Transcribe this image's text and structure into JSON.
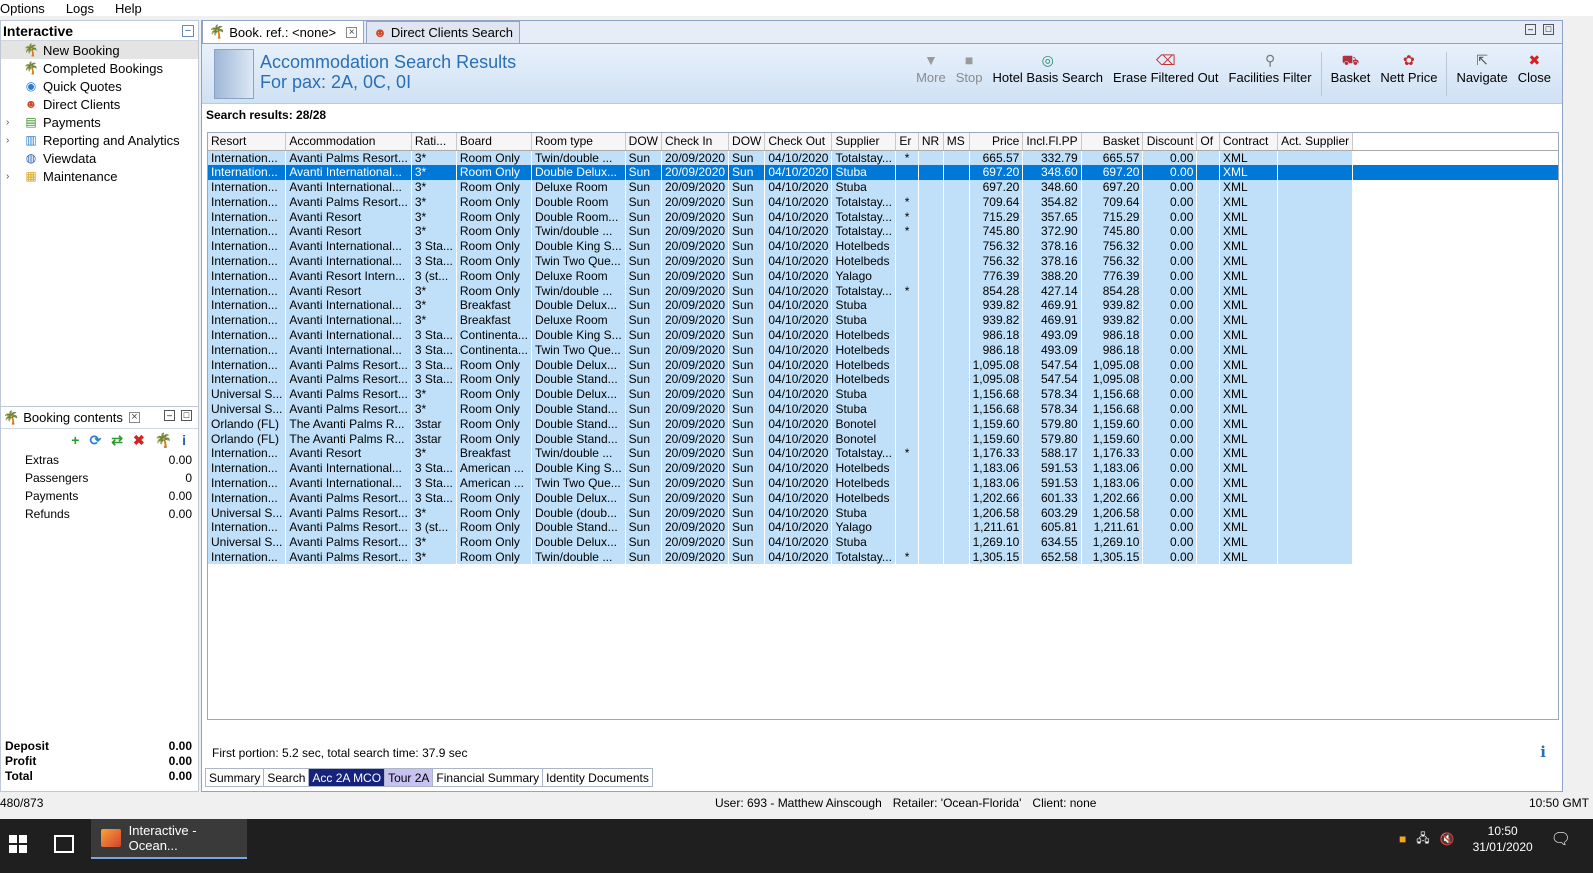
{
  "menu": [
    "Options",
    "Logs",
    "Help"
  ],
  "nav": {
    "title": "Interactive",
    "items": [
      {
        "label": "New Booking",
        "icon": "palm-tree-icon",
        "expandable": false,
        "selected": true
      },
      {
        "label": "Completed Bookings",
        "icon": "palm-tree-icon",
        "expandable": false
      },
      {
        "label": "Quick Quotes",
        "icon": "globe-icon",
        "expandable": false
      },
      {
        "label": "Direct Clients",
        "icon": "client-icon",
        "expandable": false
      },
      {
        "label": "Payments",
        "icon": "payments-icon",
        "expandable": true
      },
      {
        "label": "Reporting and Analytics",
        "icon": "chart-icon",
        "expandable": true
      },
      {
        "label": "Viewdata",
        "icon": "viewdata-icon",
        "expandable": false
      },
      {
        "label": "Maintenance",
        "icon": "books-icon",
        "expandable": true
      }
    ]
  },
  "booking": {
    "title": "Booking contents",
    "tools": [
      "add-icon",
      "refresh-icon",
      "transfer-icon",
      "delete-icon",
      "palm-tree-icon",
      "info-icon"
    ],
    "rows": [
      {
        "label": "Extras",
        "value": "0.00"
      },
      {
        "label": "Passengers",
        "value": "0"
      },
      {
        "label": "Payments",
        "value": "0.00"
      },
      {
        "label": "Refunds",
        "value": "0.00"
      }
    ],
    "summary": [
      {
        "label": "Deposit",
        "value": "0.00"
      },
      {
        "label": "Profit",
        "value": "0.00"
      },
      {
        "label": "Total",
        "value": "0.00"
      }
    ]
  },
  "tabs": [
    {
      "label": "Book. ref.: <none>",
      "active": true,
      "closable": true
    },
    {
      "label": "Direct Clients Search",
      "active": false,
      "closable": false
    }
  ],
  "header": {
    "title": "Accommodation Search Results",
    "subtitle": "For pax: 2A, 0C, 0I"
  },
  "toolbar": [
    {
      "label": "More",
      "icon": "more-icon",
      "disabled": true
    },
    {
      "label": "Stop",
      "icon": "stop-icon",
      "disabled": true
    },
    {
      "label": "Hotel Basis Search",
      "icon": "hotel-basis-search-icon",
      "disabled": false
    },
    {
      "label": "Erase Filtered Out",
      "icon": "erase-icon",
      "disabled": false
    },
    {
      "label": "Facilities Filter",
      "icon": "filter-icon",
      "disabled": false,
      "sep_after": true
    },
    {
      "label": "Basket",
      "icon": "basket-icon",
      "disabled": false
    },
    {
      "label": "Nett Price",
      "icon": "nett-price-icon",
      "disabled": false,
      "sep_after": true
    },
    {
      "label": "Navigate",
      "icon": "navigate-icon",
      "disabled": false
    },
    {
      "label": "Close",
      "icon": "close-icon",
      "disabled": false
    }
  ],
  "results_label": "Search results: 28/28",
  "columns": [
    "Resort",
    "Accommodation",
    "Rati...",
    "Board",
    "Room type",
    "DOW",
    "Check In",
    "DOW",
    "Check Out",
    "Supplier",
    "Er",
    "NR",
    "MS",
    "Price",
    "Incl.Fl.PP",
    "Basket",
    "Discount",
    "Of",
    "Contract",
    "Act. Supplier"
  ],
  "rows": [
    [
      "Internation...",
      "Avanti Palms Resort...",
      "3*",
      "Room Only",
      "Twin/double ...",
      "Sun",
      "20/09/2020",
      "Sun",
      "04/10/2020",
      "Totalstay...",
      "*",
      "",
      "",
      "665.57",
      "332.79",
      "665.57",
      "0.00",
      "",
      "XML",
      ""
    ],
    [
      "Internation...",
      "Avanti International...",
      "3*",
      "Room Only",
      "Double Delux...",
      "Sun",
      "20/09/2020",
      "Sun",
      "04/10/2020",
      "Stuba",
      "",
      "",
      "",
      "697.20",
      "348.60",
      "697.20",
      "0.00",
      "",
      "XML",
      ""
    ],
    [
      "Internation...",
      "Avanti International...",
      "3*",
      "Room Only",
      "Deluxe Room",
      "Sun",
      "20/09/2020",
      "Sun",
      "04/10/2020",
      "Stuba",
      "",
      "",
      "",
      "697.20",
      "348.60",
      "697.20",
      "0.00",
      "",
      "XML",
      ""
    ],
    [
      "Internation...",
      "Avanti Palms Resort...",
      "3*",
      "Room Only",
      "Double Room",
      "Sun",
      "20/09/2020",
      "Sun",
      "04/10/2020",
      "Totalstay...",
      "*",
      "",
      "",
      "709.64",
      "354.82",
      "709.64",
      "0.00",
      "",
      "XML",
      ""
    ],
    [
      "Internation...",
      "Avanti Resort",
      "3*",
      "Room Only",
      "Double Room...",
      "Sun",
      "20/09/2020",
      "Sun",
      "04/10/2020",
      "Totalstay...",
      "*",
      "",
      "",
      "715.29",
      "357.65",
      "715.29",
      "0.00",
      "",
      "XML",
      ""
    ],
    [
      "Internation...",
      "Avanti Resort",
      "3*",
      "Room Only",
      "Twin/double ...",
      "Sun",
      "20/09/2020",
      "Sun",
      "04/10/2020",
      "Totalstay...",
      "*",
      "",
      "",
      "745.80",
      "372.90",
      "745.80",
      "0.00",
      "",
      "XML",
      ""
    ],
    [
      "Internation...",
      "Avanti International...",
      "3 Sta...",
      "Room Only",
      "Double King S...",
      "Sun",
      "20/09/2020",
      "Sun",
      "04/10/2020",
      "Hotelbeds",
      "",
      "",
      "",
      "756.32",
      "378.16",
      "756.32",
      "0.00",
      "",
      "XML",
      ""
    ],
    [
      "Internation...",
      "Avanti International...",
      "3 Sta...",
      "Room Only",
      "Twin Two Que...",
      "Sun",
      "20/09/2020",
      "Sun",
      "04/10/2020",
      "Hotelbeds",
      "",
      "",
      "",
      "756.32",
      "378.16",
      "756.32",
      "0.00",
      "",
      "XML",
      ""
    ],
    [
      "Internation...",
      "Avanti Resort Intern...",
      "3 (st...",
      "Room Only",
      "Deluxe Room",
      "Sun",
      "20/09/2020",
      "Sun",
      "04/10/2020",
      "Yalago",
      "",
      "",
      "",
      "776.39",
      "388.20",
      "776.39",
      "0.00",
      "",
      "XML",
      ""
    ],
    [
      "Internation...",
      "Avanti Resort",
      "3*",
      "Room Only",
      "Twin/double ...",
      "Sun",
      "20/09/2020",
      "Sun",
      "04/10/2020",
      "Totalstay...",
      "*",
      "",
      "",
      "854.28",
      "427.14",
      "854.28",
      "0.00",
      "",
      "XML",
      ""
    ],
    [
      "Internation...",
      "Avanti International...",
      "3*",
      "Breakfast",
      "Double Delux...",
      "Sun",
      "20/09/2020",
      "Sun",
      "04/10/2020",
      "Stuba",
      "",
      "",
      "",
      "939.82",
      "469.91",
      "939.82",
      "0.00",
      "",
      "XML",
      ""
    ],
    [
      "Internation...",
      "Avanti International...",
      "3*",
      "Breakfast",
      "Deluxe Room",
      "Sun",
      "20/09/2020",
      "Sun",
      "04/10/2020",
      "Stuba",
      "",
      "",
      "",
      "939.82",
      "469.91",
      "939.82",
      "0.00",
      "",
      "XML",
      ""
    ],
    [
      "Internation...",
      "Avanti International...",
      "3 Sta...",
      "Continenta...",
      "Double King S...",
      "Sun",
      "20/09/2020",
      "Sun",
      "04/10/2020",
      "Hotelbeds",
      "",
      "",
      "",
      "986.18",
      "493.09",
      "986.18",
      "0.00",
      "",
      "XML",
      ""
    ],
    [
      "Internation...",
      "Avanti International...",
      "3 Sta...",
      "Continenta...",
      "Twin Two Que...",
      "Sun",
      "20/09/2020",
      "Sun",
      "04/10/2020",
      "Hotelbeds",
      "",
      "",
      "",
      "986.18",
      "493.09",
      "986.18",
      "0.00",
      "",
      "XML",
      ""
    ],
    [
      "Internation...",
      "Avanti Palms Resort...",
      "3 Sta...",
      "Room Only",
      "Double Delux...",
      "Sun",
      "20/09/2020",
      "Sun",
      "04/10/2020",
      "Hotelbeds",
      "",
      "",
      "",
      "1,095.08",
      "547.54",
      "1,095.08",
      "0.00",
      "",
      "XML",
      ""
    ],
    [
      "Internation...",
      "Avanti Palms Resort...",
      "3 Sta...",
      "Room Only",
      "Double Stand...",
      "Sun",
      "20/09/2020",
      "Sun",
      "04/10/2020",
      "Hotelbeds",
      "",
      "",
      "",
      "1,095.08",
      "547.54",
      "1,095.08",
      "0.00",
      "",
      "XML",
      ""
    ],
    [
      "Universal S...",
      "Avanti Palms Resort...",
      "3*",
      "Room Only",
      "Double Delux...",
      "Sun",
      "20/09/2020",
      "Sun",
      "04/10/2020",
      "Stuba",
      "",
      "",
      "",
      "1,156.68",
      "578.34",
      "1,156.68",
      "0.00",
      "",
      "XML",
      ""
    ],
    [
      "Universal S...",
      "Avanti Palms Resort...",
      "3*",
      "Room Only",
      "Double Stand...",
      "Sun",
      "20/09/2020",
      "Sun",
      "04/10/2020",
      "Stuba",
      "",
      "",
      "",
      "1,156.68",
      "578.34",
      "1,156.68",
      "0.00",
      "",
      "XML",
      ""
    ],
    [
      "Orlando (FL)",
      "The Avanti Palms R...",
      "3star",
      "Room Only",
      "Double Stand...",
      "Sun",
      "20/09/2020",
      "Sun",
      "04/10/2020",
      "Bonotel",
      "",
      "",
      "",
      "1,159.60",
      "579.80",
      "1,159.60",
      "0.00",
      "",
      "XML",
      ""
    ],
    [
      "Orlando (FL)",
      "The Avanti Palms R...",
      "3star",
      "Room Only",
      "Double Stand...",
      "Sun",
      "20/09/2020",
      "Sun",
      "04/10/2020",
      "Bonotel",
      "",
      "",
      "",
      "1,159.60",
      "579.80",
      "1,159.60",
      "0.00",
      "",
      "XML",
      ""
    ],
    [
      "Internation...",
      "Avanti Resort",
      "3*",
      "Breakfast",
      "Twin/double ...",
      "Sun",
      "20/09/2020",
      "Sun",
      "04/10/2020",
      "Totalstay...",
      "*",
      "",
      "",
      "1,176.33",
      "588.17",
      "1,176.33",
      "0.00",
      "",
      "XML",
      ""
    ],
    [
      "Internation...",
      "Avanti International...",
      "3 Sta...",
      "American ...",
      "Double King S...",
      "Sun",
      "20/09/2020",
      "Sun",
      "04/10/2020",
      "Hotelbeds",
      "",
      "",
      "",
      "1,183.06",
      "591.53",
      "1,183.06",
      "0.00",
      "",
      "XML",
      ""
    ],
    [
      "Internation...",
      "Avanti International...",
      "3 Sta...",
      "American ...",
      "Twin Two Que...",
      "Sun",
      "20/09/2020",
      "Sun",
      "04/10/2020",
      "Hotelbeds",
      "",
      "",
      "",
      "1,183.06",
      "591.53",
      "1,183.06",
      "0.00",
      "",
      "XML",
      ""
    ],
    [
      "Internation...",
      "Avanti Palms Resort...",
      "3 Sta...",
      "Room Only",
      "Double Delux...",
      "Sun",
      "20/09/2020",
      "Sun",
      "04/10/2020",
      "Hotelbeds",
      "",
      "",
      "",
      "1,202.66",
      "601.33",
      "1,202.66",
      "0.00",
      "",
      "XML",
      ""
    ],
    [
      "Universal S...",
      "Avanti Palms Resort...",
      "3*",
      "Room Only",
      "Double (doub...",
      "Sun",
      "20/09/2020",
      "Sun",
      "04/10/2020",
      "Stuba",
      "",
      "",
      "",
      "1,206.58",
      "603.29",
      "1,206.58",
      "0.00",
      "",
      "XML",
      ""
    ],
    [
      "Internation...",
      "Avanti Palms Resort...",
      "3 (st...",
      "Room Only",
      "Double Stand...",
      "Sun",
      "20/09/2020",
      "Sun",
      "04/10/2020",
      "Yalago",
      "",
      "",
      "",
      "1,211.61",
      "605.81",
      "1,211.61",
      "0.00",
      "",
      "XML",
      ""
    ],
    [
      "Universal S...",
      "Avanti Palms Resort...",
      "3*",
      "Room Only",
      "Double Delux...",
      "Sun",
      "20/09/2020",
      "Sun",
      "04/10/2020",
      "Stuba",
      "",
      "",
      "",
      "1,269.10",
      "634.55",
      "1,269.10",
      "0.00",
      "",
      "XML",
      ""
    ],
    [
      "Internation...",
      "Avanti Palms Resort...",
      "3*",
      "Room Only",
      "Twin/double ...",
      "Sun",
      "20/09/2020",
      "Sun",
      "04/10/2020",
      "Totalstay...",
      "*",
      "",
      "",
      "1,305.15",
      "652.58",
      "1,305.15",
      "0.00",
      "",
      "XML",
      ""
    ]
  ],
  "selected_row": 1,
  "footer_note": "First portion: 5.2 sec, total search time: 37.9 sec",
  "bottom_tabs": [
    {
      "label": "Summary",
      "style": "plain"
    },
    {
      "label": "Search",
      "style": "plain"
    },
    {
      "label": "Acc 2A MCO",
      "style": "navy"
    },
    {
      "label": "Tour 2A",
      "style": "lav"
    },
    {
      "label": "Financial Summary",
      "style": "plain"
    },
    {
      "label": "Identity Documents",
      "style": "plain"
    }
  ],
  "status": {
    "left": "480/873",
    "user": "User: 693 - Matthew Ainscough",
    "retailer": "Retailer: 'Ocean-Florida'",
    "client": "Client: none",
    "time": "10:50 GMT"
  },
  "taskbar": {
    "app_label": "Interactive - Ocean...",
    "clock_time": "10:50",
    "clock_date": "31/01/2020"
  },
  "colors": {
    "row_bg": "#bfe0f8",
    "selected_row_bg": "#0078d7",
    "header_title": "#2a6fb5",
    "navy_tab": "#16227b",
    "lavender_tab": "#c7c2f2"
  }
}
